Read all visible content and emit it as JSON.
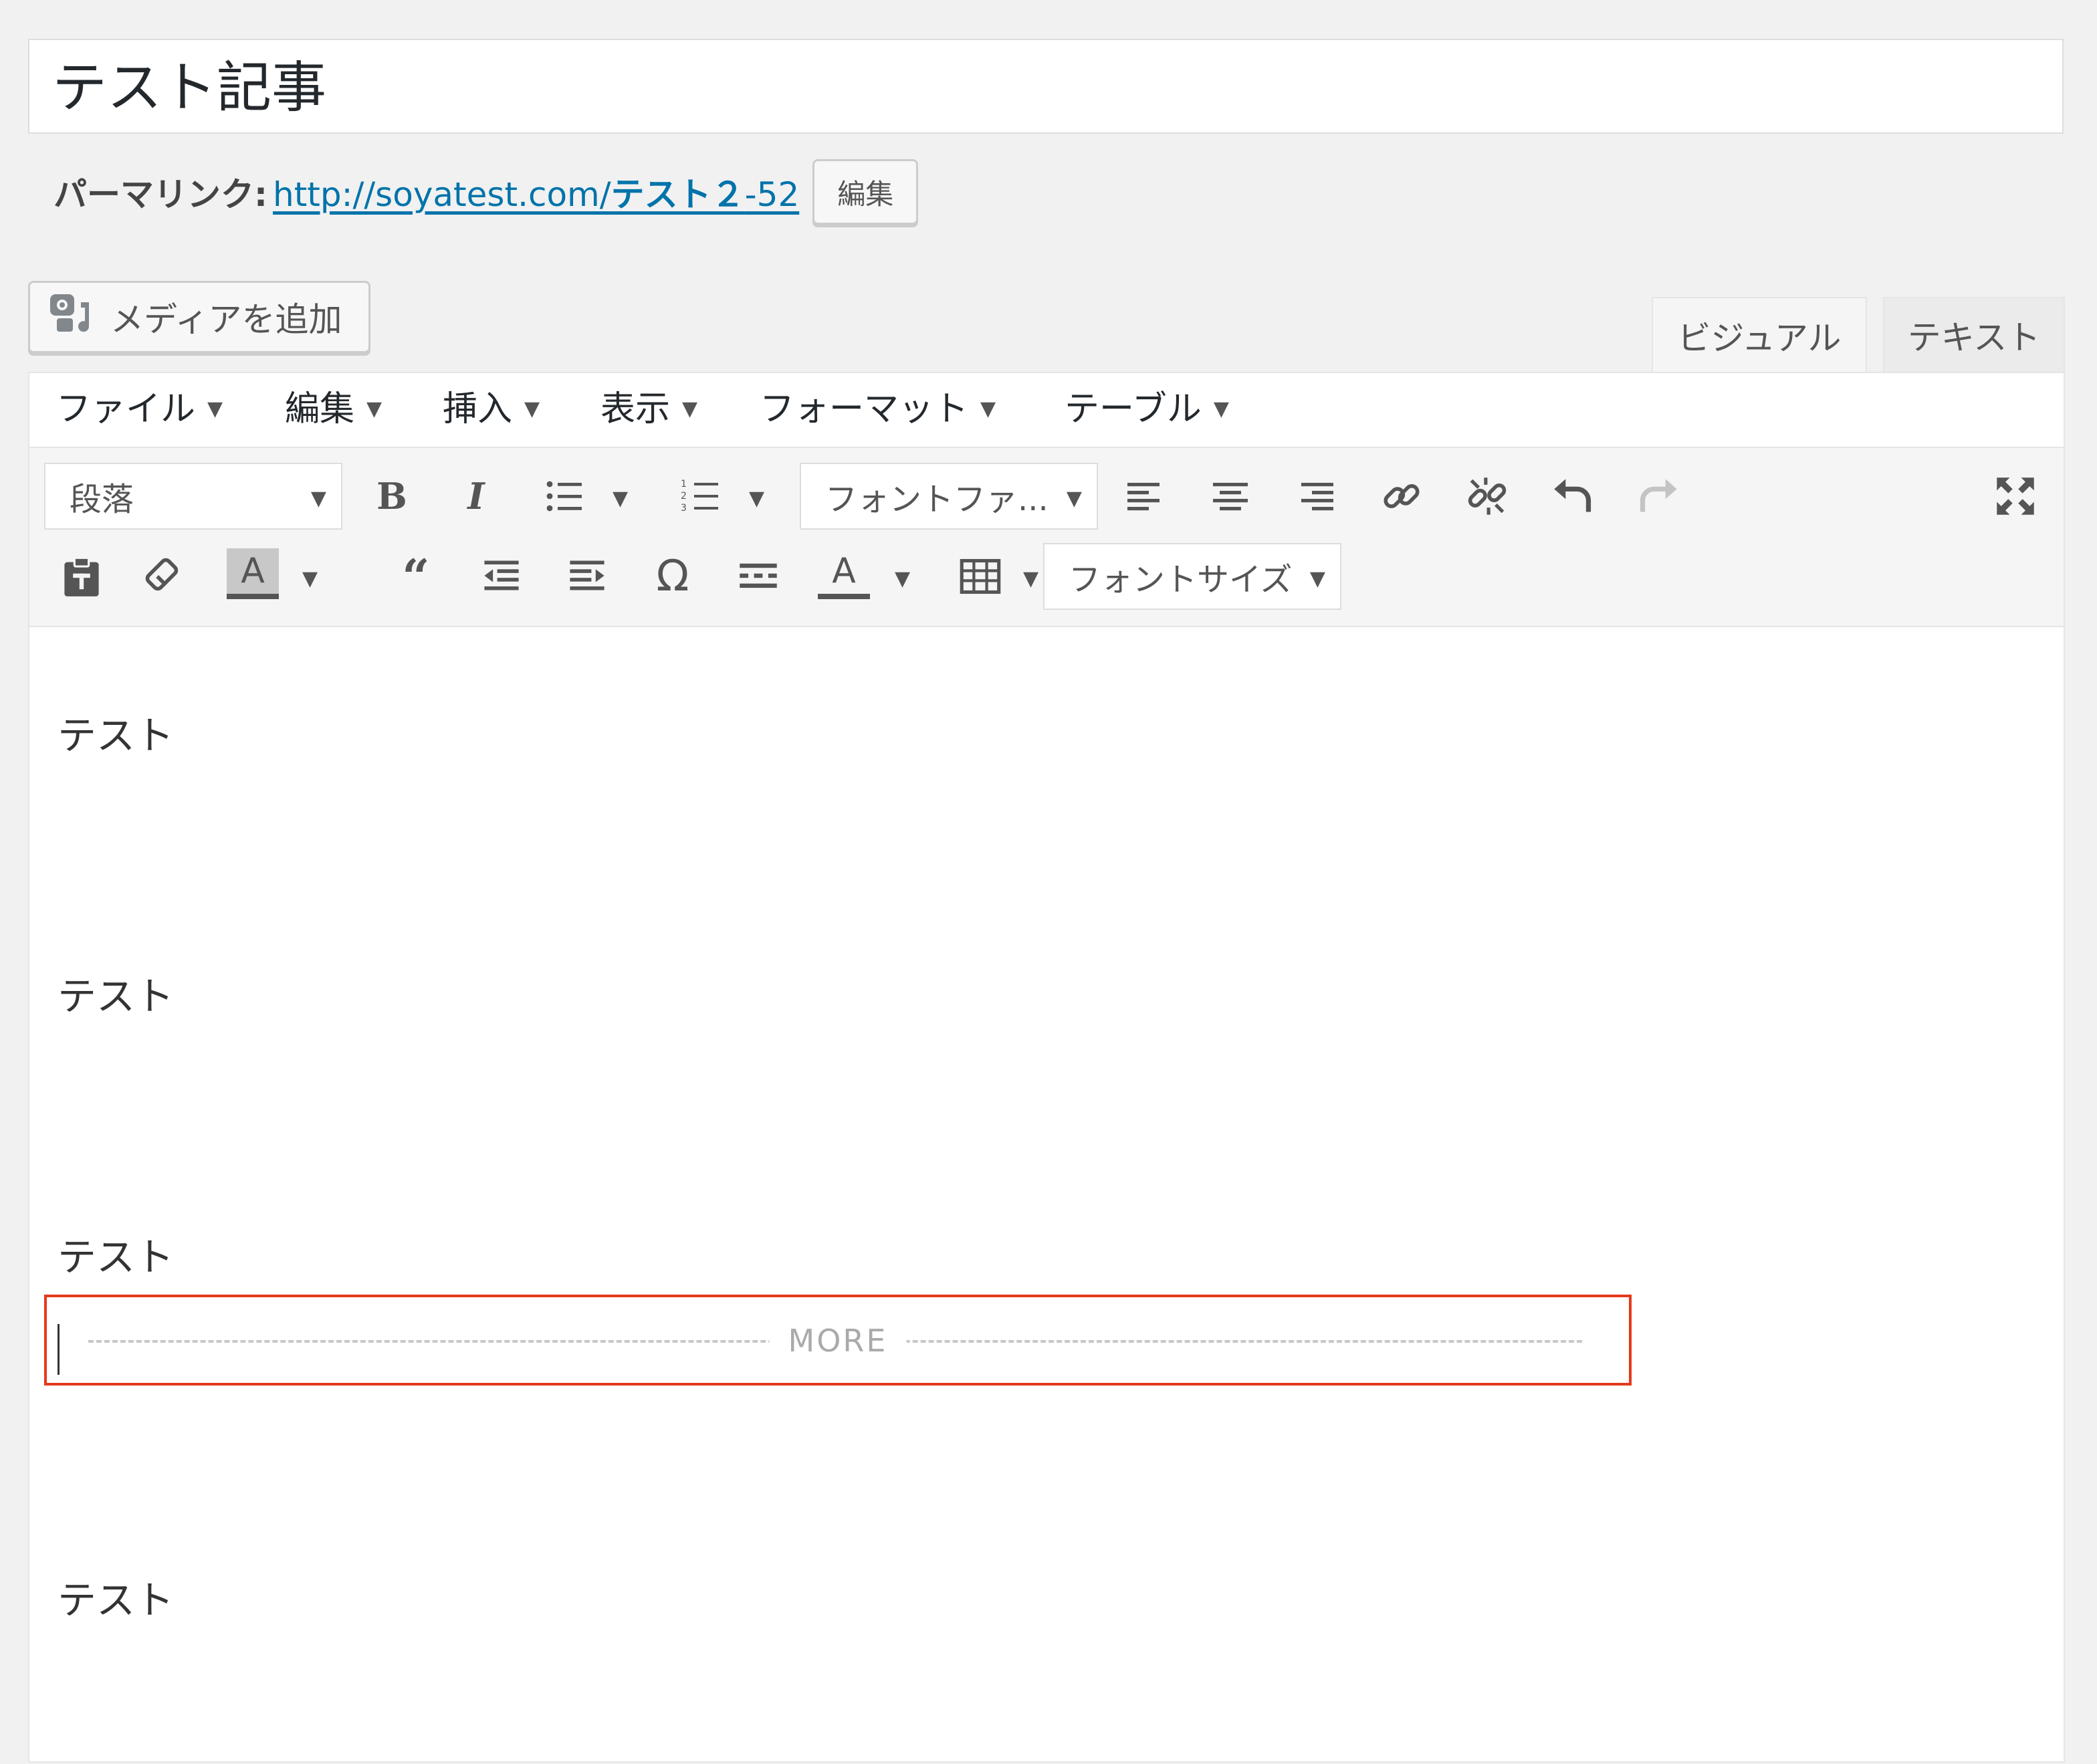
{
  "post": {
    "title": "テスト記事"
  },
  "permalink": {
    "label": "パーマリンク:",
    "url_base": "http://soyatest.com/",
    "slug": "テスト２",
    "suffix": "-52",
    "edit_label": "編集"
  },
  "media": {
    "add_label": "メディアを追加"
  },
  "tabs": {
    "visual": "ビジュアル",
    "text": "テキスト"
  },
  "menu": {
    "file": "ファイル",
    "edit": "編集",
    "insert": "挿入",
    "view": "表示",
    "format": "フォーマット",
    "table": "テーブル"
  },
  "toolbar": {
    "paragraph": "段落",
    "font_family": "フォントファ...",
    "font_size": "フォントサイズ",
    "bold_glyph": "B",
    "italic_glyph": "I",
    "omega_glyph": "Ω",
    "text_color_glyph": "A",
    "bg_color_glyph": "A"
  },
  "content": {
    "paragraphs": [
      "テスト",
      "テスト",
      "テスト",
      "テスト"
    ],
    "more_label": "MORE"
  },
  "colors": {
    "link": "#0073aa",
    "highlight_border": "#e4391b"
  }
}
